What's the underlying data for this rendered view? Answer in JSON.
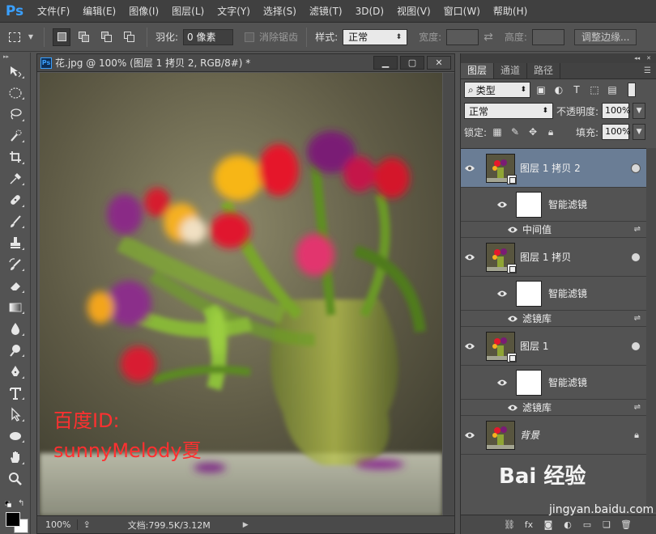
{
  "app": {
    "logo": "Ps",
    "menu": [
      "文件(F)",
      "编辑(E)",
      "图像(I)",
      "图层(L)",
      "文字(Y)",
      "选择(S)",
      "滤镜(T)",
      "3D(D)",
      "视图(V)",
      "窗口(W)",
      "帮助(H)"
    ]
  },
  "options": {
    "feather_label": "羽化:",
    "feather_value": "0 像素",
    "antialias_label": "消除锯齿",
    "style_label": "样式:",
    "style_value": "正常",
    "width_label": "宽度:",
    "height_label": "高度:",
    "refine_label": "调整边缘..."
  },
  "document": {
    "title": "花.jpg @ 100% (图层 1 拷贝 2, RGB/8#) *",
    "zoom": "100%",
    "doc_info": "文档:799.5K/3.12M",
    "watermark_line1": "百度ID:",
    "watermark_line2": "sunnyMelody夏"
  },
  "panel": {
    "tabs": [
      "图层",
      "通道",
      "路径"
    ],
    "filter_kind": "类型",
    "blend_mode": "正常",
    "opacity_label": "不透明度:",
    "opacity_value": "100%",
    "lock_label": "锁定:",
    "fill_label": "填充:",
    "fill_value": "100%",
    "layers": [
      {
        "name": "图层 1 拷贝 2",
        "selected": true,
        "smart_filter": "智能滤镜",
        "filter": "中间值"
      },
      {
        "name": "图层 1 拷贝",
        "selected": false,
        "smart_filter": "智能滤镜",
        "filter": "滤镜库"
      },
      {
        "name": "图层 1",
        "selected": false,
        "smart_filter": "智能滤镜",
        "filter": "滤镜库"
      },
      {
        "name": "背景",
        "selected": false,
        "locked": true
      }
    ]
  },
  "site_watermark": {
    "brand": "Bai 经验",
    "url": "jingyan.baidu.com"
  }
}
